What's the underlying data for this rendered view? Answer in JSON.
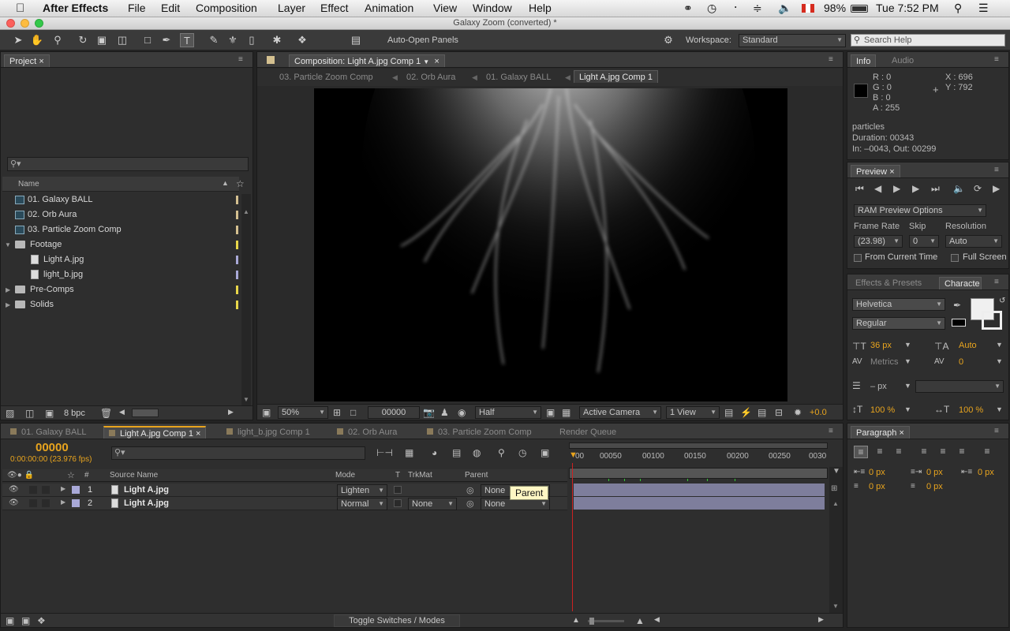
{
  "menubar": {
    "app_name": "After Effects",
    "items": [
      "File",
      "Edit",
      "Composition",
      "Layer",
      "Effect",
      "Animation",
      "View",
      "Window",
      "Help"
    ],
    "battery": "98%",
    "clock": "Tue 7:52 PM"
  },
  "window": {
    "title": "Galaxy Zoom (converted) *"
  },
  "toolbar": {
    "auto_open_label": "Auto-Open Panels",
    "workspace_label": "Workspace:",
    "workspace_value": "Standard",
    "search_placeholder": "Search Help"
  },
  "project": {
    "tab_label": "Project",
    "col_name": "Name",
    "items": [
      {
        "label": "01. Galaxy BALL",
        "type": "comp",
        "indent": 0,
        "color": "#d4c090"
      },
      {
        "label": "02. Orb Aura",
        "type": "comp",
        "indent": 0,
        "color": "#d4c090"
      },
      {
        "label": "03. Particle Zoom Comp",
        "type": "comp",
        "indent": 0,
        "color": "#d4c090"
      },
      {
        "label": "Footage",
        "type": "folder-open",
        "indent": 0,
        "color": "#e8d64a"
      },
      {
        "label": "Light A.jpg",
        "type": "file",
        "indent": 1,
        "color": "#a9a9d8"
      },
      {
        "label": "light_b.jpg",
        "type": "file",
        "indent": 1,
        "color": "#a9a9d8"
      },
      {
        "label": "Pre-Comps",
        "type": "folder",
        "indent": 0,
        "color": "#e8d64a"
      },
      {
        "label": "Solids",
        "type": "folder",
        "indent": 0,
        "color": "#e8d64a"
      }
    ],
    "bpc": "8 bpc"
  },
  "composition": {
    "tab_label": "Composition: Light A.jpg Comp 1",
    "breadcrumbs": [
      "03. Particle Zoom Comp",
      "02. Orb Aura",
      "01. Galaxy BALL",
      "Light A.jpg Comp 1"
    ],
    "zoom": "50%",
    "timecode": "00000",
    "resolution": "Half",
    "camera": "Active Camera",
    "views": "1 View",
    "exposure": "+0.0"
  },
  "info": {
    "tab_label": "Info",
    "tab_audio": "Audio",
    "r": "R : 0",
    "g": "G : 0",
    "b": "B : 0",
    "a": "A : 255",
    "x": "X : 696",
    "y": "Y : 792",
    "name": "particles",
    "duration": "Duration: 00343",
    "inout": "In: –0043, Out: 00299"
  },
  "preview": {
    "tab_label": "Preview",
    "ram_options": "RAM Preview Options",
    "frame_rate_label": "Frame Rate",
    "skip_label": "Skip",
    "resolution_label": "Resolution",
    "frame_rate": "(23.98)",
    "skip": "0",
    "resolution": "Auto",
    "from_current": "From Current Time",
    "full_screen": "Full Screen"
  },
  "character": {
    "tab_effects": "Effects & Presets",
    "tab_char": "Characte",
    "font": "Helvetica",
    "style": "Regular",
    "size": "36 px",
    "leading": "Auto",
    "kerning": "Metrics",
    "tracking": "0",
    "stroke": "– px",
    "vscale": "100 %",
    "hscale": "100 %"
  },
  "paragraph": {
    "tab_label": "Paragraph",
    "vals": [
      "0 px",
      "0 px",
      "0 px",
      "0 px",
      "0 px"
    ]
  },
  "timeline": {
    "tabs": [
      "01. Galaxy BALL",
      "Light A.jpg Comp 1",
      "light_b.jpg Comp 1",
      "02. Orb Aura",
      "03. Particle Zoom Comp",
      "Render Queue"
    ],
    "timecode": "00000",
    "timecode_sub": "0:00:00:00 (23.976 fps)",
    "cols": {
      "hash": "#",
      "source": "Source Name",
      "mode": "Mode",
      "t": "T",
      "trkmat": "TrkMat",
      "parent": "Parent"
    },
    "layers": [
      {
        "num": "1",
        "name": "Light A.jpg",
        "mode": "Lighten",
        "trkmat": "",
        "parent": "None"
      },
      {
        "num": "2",
        "name": "Light A.jpg",
        "mode": "Normal",
        "trkmat": "None",
        "parent": "None"
      }
    ],
    "tooltip": "Parent",
    "ruler": [
      "00",
      "00050",
      "00100",
      "00150",
      "00200",
      "00250",
      "0030"
    ],
    "toggle": "Toggle Switches / Modes"
  }
}
